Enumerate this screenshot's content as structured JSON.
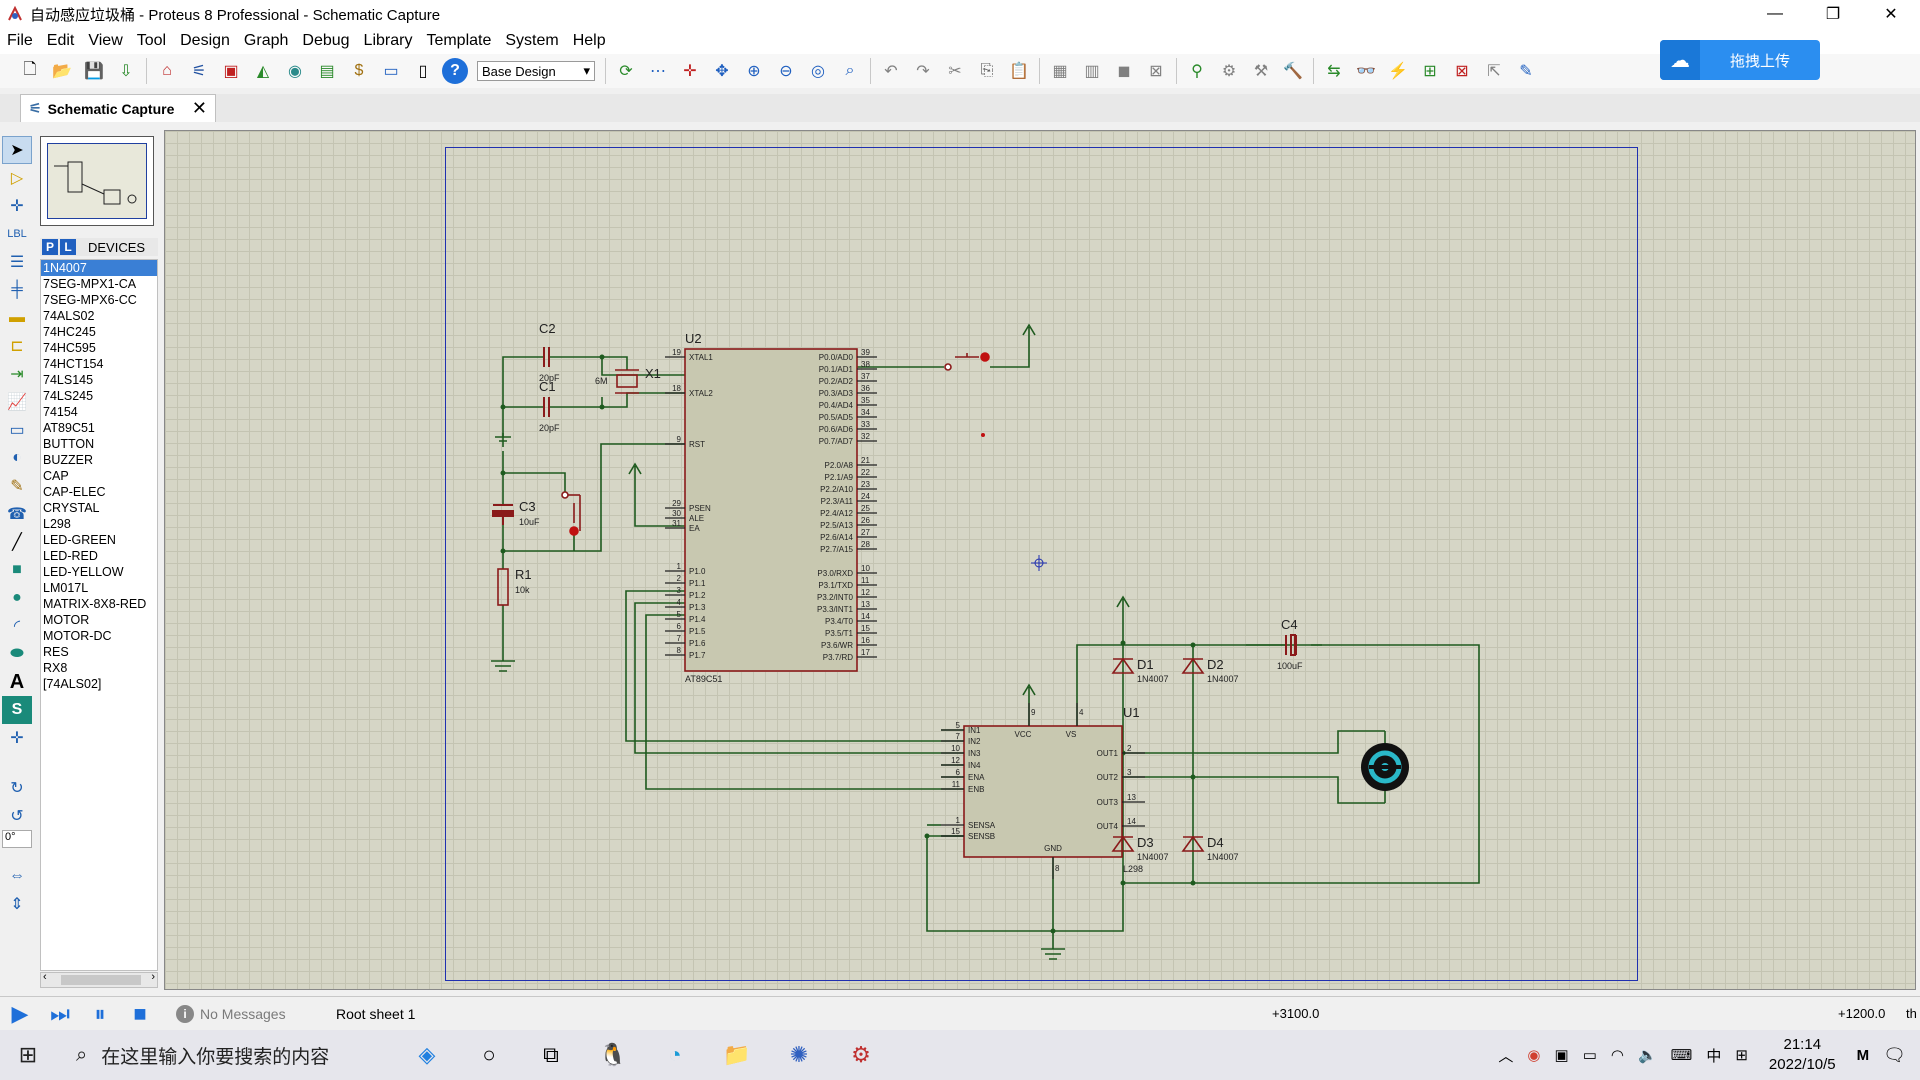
{
  "window": {
    "title": "自动感应垃圾桶 - Proteus 8 Professional - Schematic Capture",
    "minimize": "—",
    "maximize": "❐",
    "close": "✕"
  },
  "menu": [
    "File",
    "Edit",
    "View",
    "Tool",
    "Design",
    "Graph",
    "Debug",
    "Library",
    "Template",
    "System",
    "Help"
  ],
  "toolbar": {
    "design_select": "Base Design"
  },
  "upload": {
    "label": "拖拽上传"
  },
  "tab": {
    "label": "Schematic Capture"
  },
  "devices": {
    "header": "DEVICES",
    "p_label": "P",
    "l_label": "L",
    "items": [
      "1N4007",
      "7SEG-MPX1-CA",
      "7SEG-MPX6-CC",
      "74ALS02",
      "74HC245",
      "74HC595",
      "74HCT154",
      "74LS145",
      "74LS245",
      "74154",
      "AT89C51",
      "BUTTON",
      "BUZZER",
      "CAP",
      "CAP-ELEC",
      "CRYSTAL",
      "L298",
      "LED-GREEN",
      "LED-RED",
      "LED-YELLOW",
      "LM017L",
      "MATRIX-8X8-RED",
      "MOTOR",
      "MOTOR-DC",
      "RES",
      "RX8",
      "[74ALS02]"
    ],
    "selected": 0
  },
  "rotation": "0°",
  "schematic": {
    "u2": {
      "ref": "U2",
      "part": "AT89C51",
      "left_pins": [
        [
          "19",
          "XTAL1"
        ],
        [
          "18",
          "XTAL2"
        ],
        [
          "9",
          "RST"
        ],
        [
          "29",
          "PSEN"
        ],
        [
          "30",
          "ALE"
        ],
        [
          "31",
          "EA"
        ],
        [
          "1",
          "P1.0"
        ],
        [
          "2",
          "P1.1"
        ],
        [
          "3",
          "P1.2"
        ],
        [
          "4",
          "P1.3"
        ],
        [
          "5",
          "P1.4"
        ],
        [
          "6",
          "P1.5"
        ],
        [
          "7",
          "P1.6"
        ],
        [
          "8",
          "P1.7"
        ]
      ],
      "right_pins": [
        [
          "39",
          "P0.0/AD0"
        ],
        [
          "38",
          "P0.1/AD1"
        ],
        [
          "37",
          "P0.2/AD2"
        ],
        [
          "36",
          "P0.3/AD3"
        ],
        [
          "35",
          "P0.4/AD4"
        ],
        [
          "34",
          "P0.5/AD5"
        ],
        [
          "33",
          "P0.6/AD6"
        ],
        [
          "32",
          "P0.7/AD7"
        ],
        [
          "21",
          "P2.0/A8"
        ],
        [
          "22",
          "P2.1/A9"
        ],
        [
          "23",
          "P2.2/A10"
        ],
        [
          "24",
          "P2.3/A11"
        ],
        [
          "25",
          "P2.4/A12"
        ],
        [
          "26",
          "P2.5/A13"
        ],
        [
          "27",
          "P2.6/A14"
        ],
        [
          "28",
          "P2.7/A15"
        ],
        [
          "10",
          "P3.0/RXD"
        ],
        [
          "11",
          "P3.1/TXD"
        ],
        [
          "12",
          "P3.2/INT0"
        ],
        [
          "13",
          "P3.3/INT1"
        ],
        [
          "14",
          "P3.4/T0"
        ],
        [
          "15",
          "P3.5/T1"
        ],
        [
          "16",
          "P3.6/WR"
        ],
        [
          "17",
          "P3.7/RD"
        ]
      ]
    },
    "u1": {
      "ref": "U1",
      "part": "L298",
      "left_pins": [
        [
          "5",
          "IN1"
        ],
        [
          "7",
          "IN2"
        ],
        [
          "10",
          "IN3"
        ],
        [
          "12",
          "IN4"
        ],
        [
          "6",
          "ENA"
        ],
        [
          "11",
          "ENB"
        ],
        [
          "1",
          "SENSA"
        ],
        [
          "15",
          "SENSB"
        ]
      ],
      "right_pins": [
        [
          "2",
          "OUT1"
        ],
        [
          "3",
          "OUT2"
        ],
        [
          "13",
          "OUT3"
        ],
        [
          "14",
          "OUT4"
        ]
      ],
      "top": [
        [
          "9",
          "VCC"
        ],
        [
          "4",
          "VS"
        ]
      ],
      "bottom": [
        [
          "8",
          "GND"
        ]
      ]
    },
    "c2": {
      "ref": "C2",
      "value": "20pF"
    },
    "c1": {
      "ref": "C1",
      "value": "20pF"
    },
    "x1": {
      "ref": "X1",
      "value": "6M"
    },
    "c3": {
      "ref": "C3",
      "value": "10uF"
    },
    "r1": {
      "ref": "R1",
      "value": "10k"
    },
    "c4": {
      "ref": "C4",
      "value": "100uF"
    },
    "d1": {
      "ref": "D1",
      "value": "1N4007"
    },
    "d2": {
      "ref": "D2",
      "value": "1N4007"
    },
    "d3": {
      "ref": "D3",
      "value": "1N4007"
    },
    "d4": {
      "ref": "D4",
      "value": "1N4007"
    }
  },
  "status": {
    "messages": "No Messages",
    "sheet": "Root sheet 1",
    "x": "+3100.0",
    "y": "+1200.0",
    "th": "th"
  },
  "taskbar": {
    "search_placeholder": "在这里输入你要搜索的内容",
    "ime": "中",
    "time": "21:14",
    "date": "2022/10/5"
  }
}
